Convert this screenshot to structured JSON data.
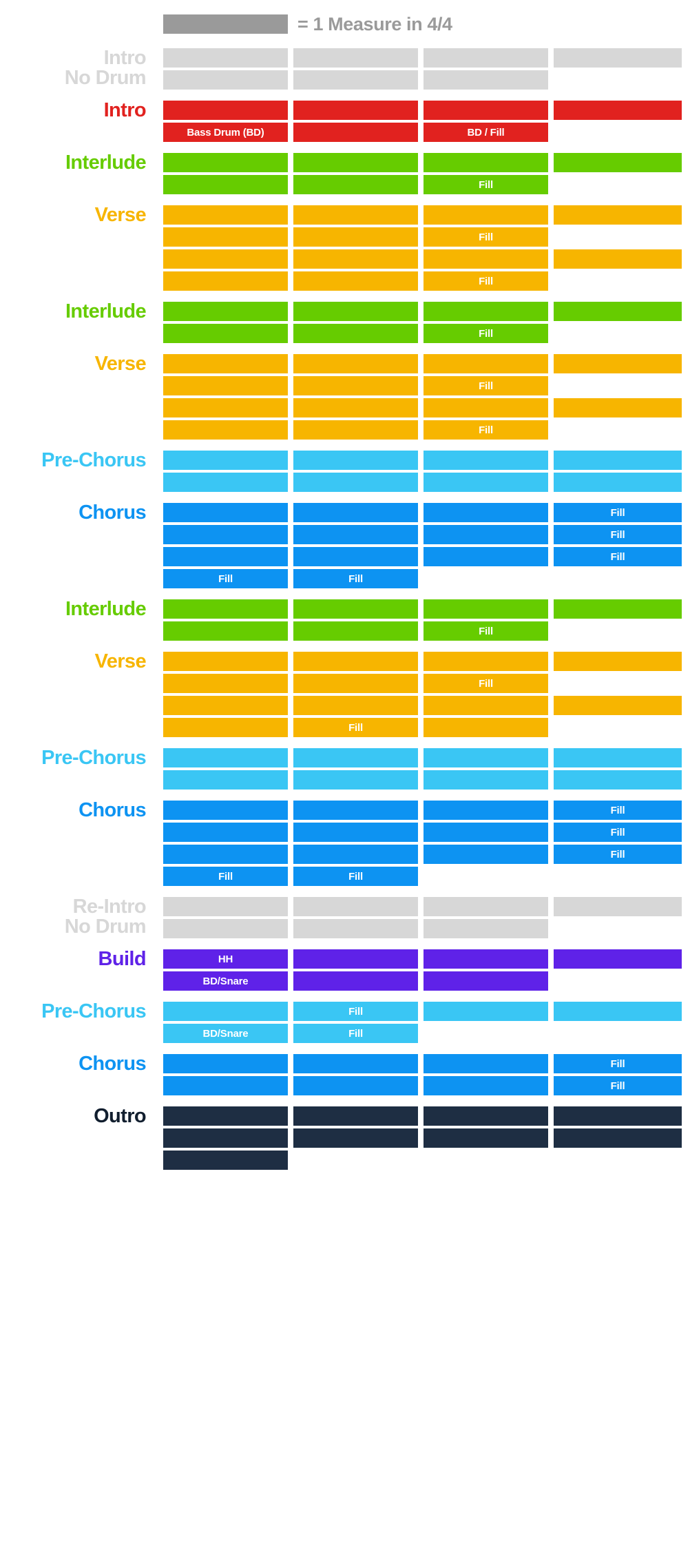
{
  "legend": {
    "swatch_name": "measure-swatch",
    "text": "= 1 Measure in 4/4",
    "color": "#9a9a9a"
  },
  "colors": {
    "no_drum": "#d7d7d7",
    "intro": "#e1221f",
    "interlude": "#66cc00",
    "verse": "#f7b500",
    "pre_chorus": "#3ac6f4",
    "chorus": "#0d93f2",
    "build": "#5f22e8",
    "outro": "#1e2e43"
  },
  "chart_data": {
    "type": "table",
    "title": "= 1 Measure in 4/4",
    "columns": 4,
    "column_note": "each cell = 1 measure in 4/4",
    "sections": [
      {
        "label": "Intro\nNo Drum",
        "label_color": "#d7d7d7",
        "bar_color": "#d7d7d7",
        "rows": [
          [
            "",
            "",
            "",
            ""
          ],
          [
            "",
            "",
            "",
            null
          ]
        ]
      },
      {
        "label": "Intro",
        "label_color": "#e1221f",
        "bar_color": "#e1221f",
        "rows": [
          [
            "",
            "",
            "",
            ""
          ],
          [
            "Bass Drum (BD)",
            "",
            "BD / Fill",
            null
          ]
        ]
      },
      {
        "label": "Interlude",
        "label_color": "#66cc00",
        "bar_color": "#66cc00",
        "rows": [
          [
            "",
            "",
            "",
            ""
          ],
          [
            "",
            "",
            "Fill",
            null
          ]
        ]
      },
      {
        "label": "Verse",
        "label_color": "#f7b500",
        "bar_color": "#f7b500",
        "rows": [
          [
            "",
            "",
            "",
            ""
          ],
          [
            "",
            "",
            "Fill",
            null
          ],
          [
            "",
            "",
            "",
            ""
          ],
          [
            "",
            "",
            "Fill",
            null
          ]
        ]
      },
      {
        "label": "Interlude",
        "label_color": "#66cc00",
        "bar_color": "#66cc00",
        "rows": [
          [
            "",
            "",
            "",
            ""
          ],
          [
            "",
            "",
            "Fill",
            null
          ]
        ]
      },
      {
        "label": "Verse",
        "label_color": "#f7b500",
        "bar_color": "#f7b500",
        "rows": [
          [
            "",
            "",
            "",
            ""
          ],
          [
            "",
            "",
            "Fill",
            null
          ],
          [
            "",
            "",
            "",
            ""
          ],
          [
            "",
            "",
            "Fill",
            null
          ]
        ]
      },
      {
        "label": "Pre-Chorus",
        "label_color": "#3ac6f4",
        "bar_color": "#3ac6f4",
        "rows": [
          [
            "",
            "",
            "",
            ""
          ],
          [
            "",
            "",
            "",
            ""
          ]
        ]
      },
      {
        "label": "Chorus",
        "label_color": "#0d93f2",
        "bar_color": "#0d93f2",
        "rows": [
          [
            "",
            "",
            "",
            "Fill"
          ],
          [
            "",
            "",
            "",
            "Fill"
          ],
          [
            "",
            "",
            "",
            "Fill"
          ],
          [
            "Fill",
            "Fill",
            null,
            null
          ]
        ]
      },
      {
        "label": "Interlude",
        "label_color": "#66cc00",
        "bar_color": "#66cc00",
        "rows": [
          [
            "",
            "",
            "",
            ""
          ],
          [
            "",
            "",
            "Fill",
            null
          ]
        ]
      },
      {
        "label": "Verse",
        "label_color": "#f7b500",
        "bar_color": "#f7b500",
        "rows": [
          [
            "",
            "",
            "",
            ""
          ],
          [
            "",
            "",
            "Fill",
            null
          ],
          [
            "",
            "",
            "",
            ""
          ],
          [
            "",
            "Fill",
            "",
            null
          ]
        ]
      },
      {
        "label": "Pre-Chorus",
        "label_color": "#3ac6f4",
        "bar_color": "#3ac6f4",
        "rows": [
          [
            "",
            "",
            "",
            ""
          ],
          [
            "",
            "",
            "",
            ""
          ]
        ]
      },
      {
        "label": "Chorus",
        "label_color": "#0d93f2",
        "bar_color": "#0d93f2",
        "rows": [
          [
            "",
            "",
            "",
            "Fill"
          ],
          [
            "",
            "",
            "",
            "Fill"
          ],
          [
            "",
            "",
            "",
            "Fill"
          ],
          [
            "Fill",
            "Fill",
            null,
            null
          ]
        ]
      },
      {
        "label": "Re-Intro\nNo Drum",
        "label_color": "#d7d7d7",
        "bar_color": "#d7d7d7",
        "rows": [
          [
            "",
            "",
            "",
            ""
          ],
          [
            "",
            "",
            "",
            null
          ]
        ]
      },
      {
        "label": "Build",
        "label_color": "#5f22e8",
        "bar_color": "#5f22e8",
        "rows": [
          [
            "HH",
            "",
            "",
            ""
          ],
          [
            "BD/Snare",
            "",
            "",
            null
          ]
        ]
      },
      {
        "label": "Pre-Chorus",
        "label_color": "#3ac6f4",
        "bar_color": "#3ac6f4",
        "rows": [
          [
            "",
            "Fill",
            "",
            ""
          ],
          [
            "BD/Snare",
            "Fill",
            null,
            null
          ]
        ]
      },
      {
        "label": "Chorus",
        "label_color": "#0d93f2",
        "bar_color": "#0d93f2",
        "rows": [
          [
            "",
            "",
            "",
            "Fill"
          ],
          [
            "",
            "",
            "",
            "Fill"
          ]
        ]
      },
      {
        "label": "Outro",
        "label_color": "#111e2e",
        "bar_color": "#1e2e43",
        "rows": [
          [
            "",
            "",
            "",
            ""
          ],
          [
            "",
            "",
            "",
            ""
          ],
          [
            "",
            null,
            null,
            null
          ]
        ]
      }
    ]
  }
}
